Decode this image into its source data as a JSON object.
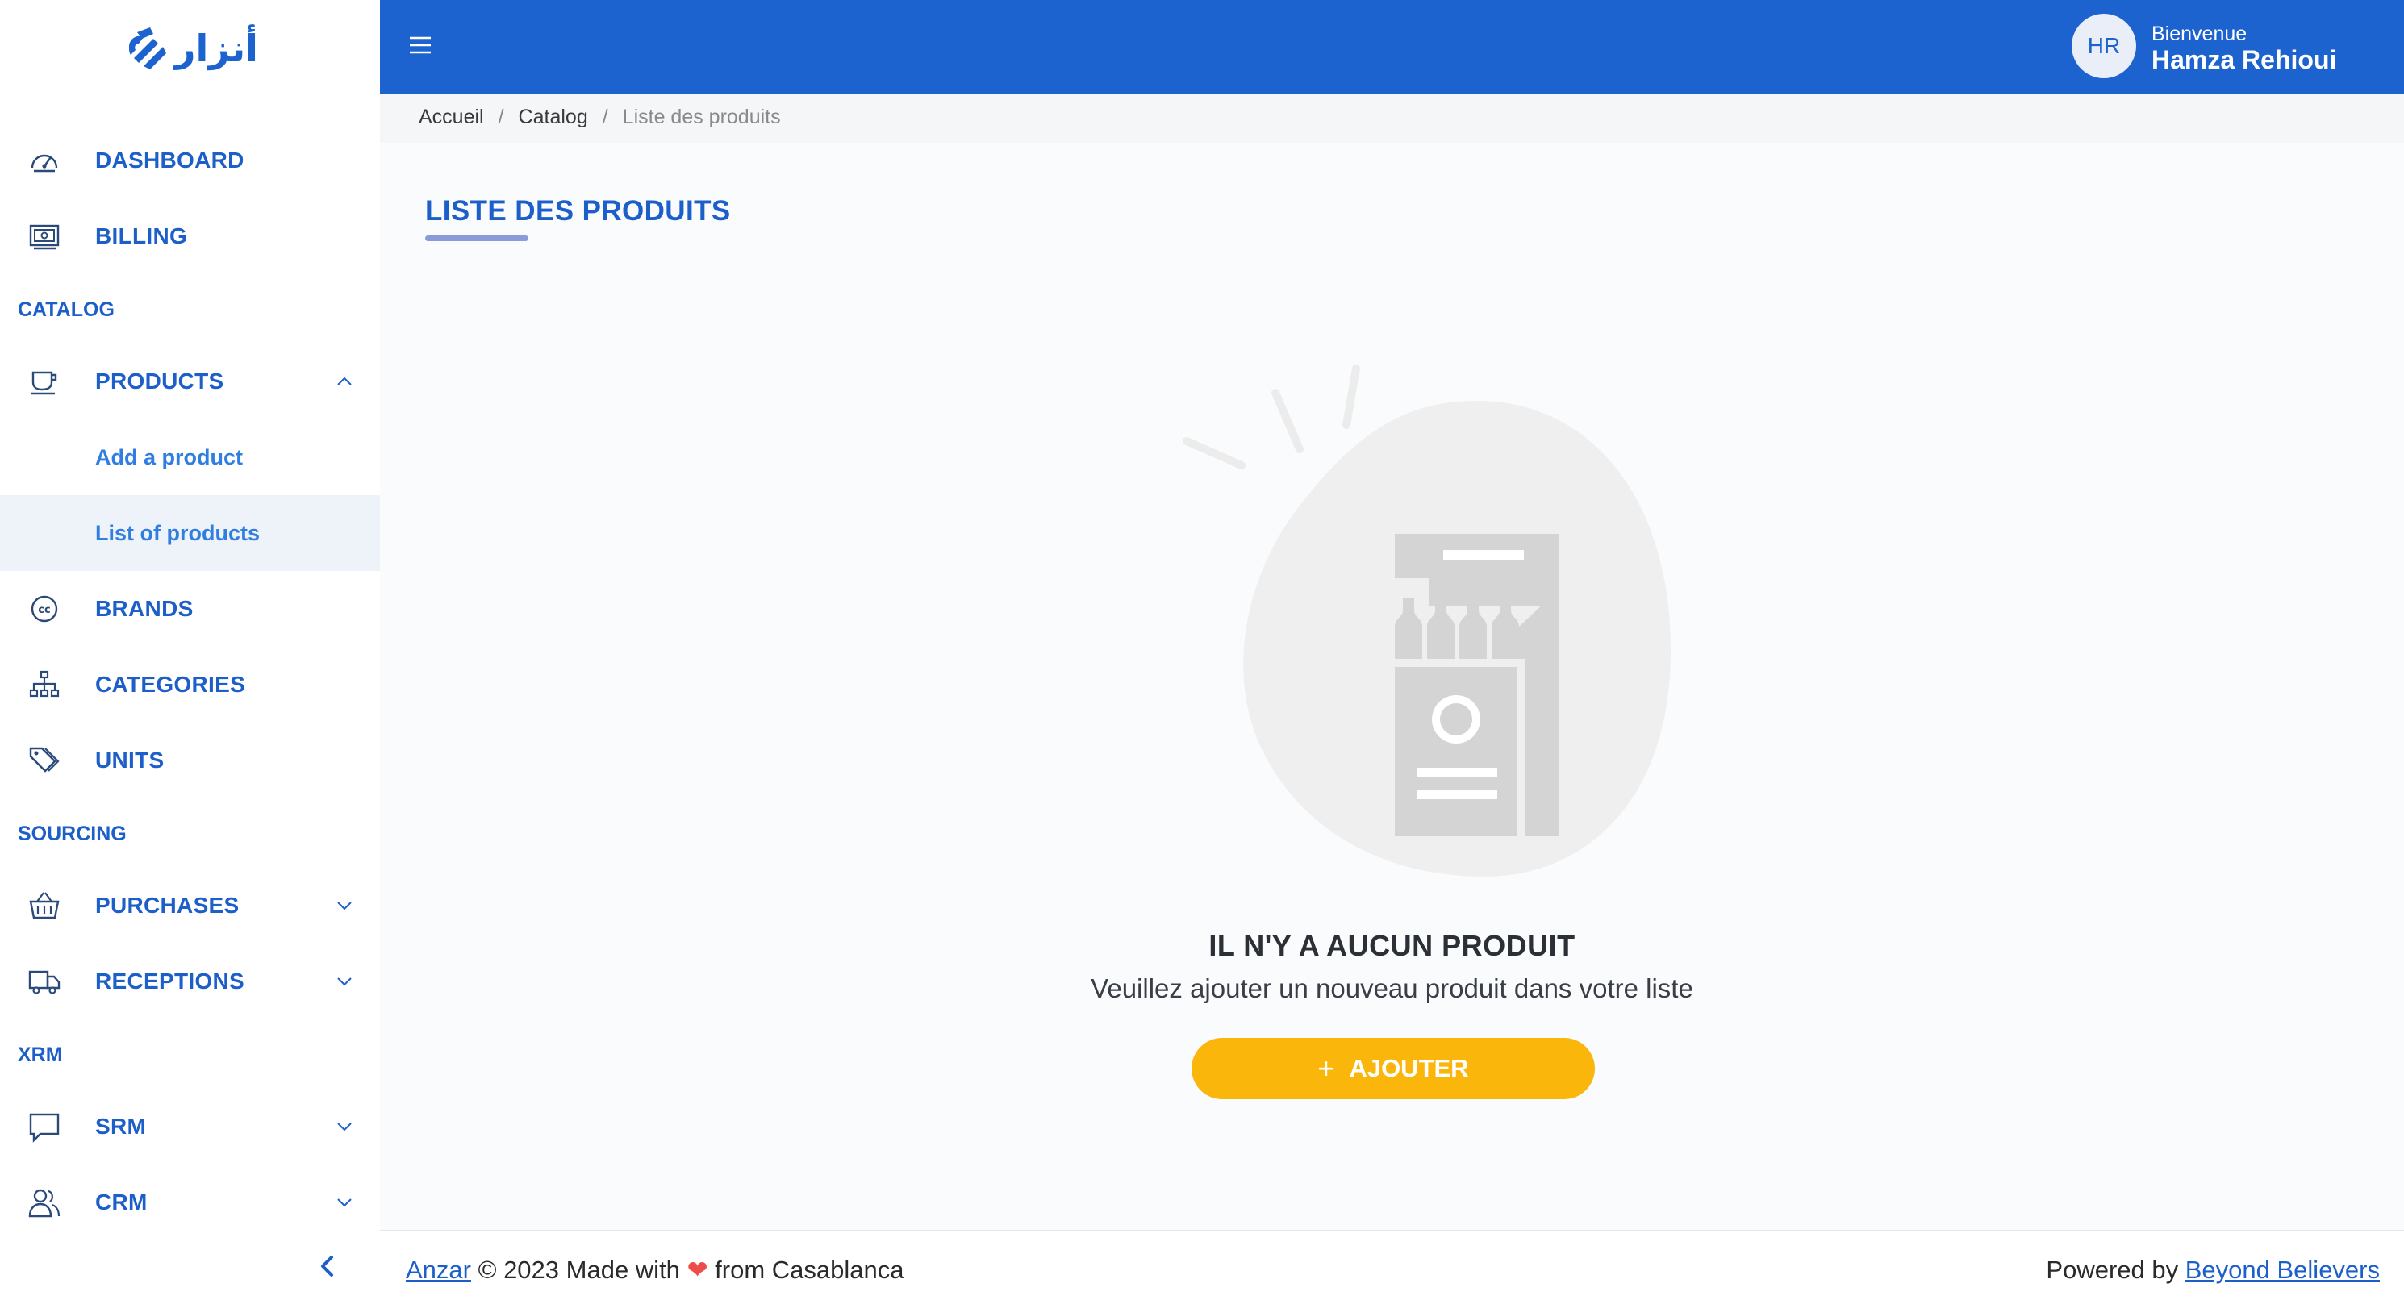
{
  "brand": {
    "logo_text": "أنزار"
  },
  "topbar": {
    "avatar_initials": "HR",
    "welcome": "Bienvenue",
    "user_name": "Hamza Rehioui"
  },
  "sidebar": {
    "items": {
      "dashboard": "DASHBOARD",
      "billing": "BILLING",
      "catalog_section": "CATALOG",
      "products": "PRODUCTS",
      "add_product": "Add a product",
      "list_products": "List of products",
      "brands": "BRANDS",
      "categories": "CATEGORIES",
      "units": "UNITS",
      "sourcing_section": "SOURCING",
      "purchases": "PURCHASES",
      "receptions": "RECEPTIONS",
      "xrm_section": "XRM",
      "srm": "SRM",
      "crm": "CRM"
    }
  },
  "breadcrumb": {
    "home": "Accueil",
    "catalog": "Catalog",
    "current": "Liste des produits",
    "separator": "/"
  },
  "main": {
    "title": "LISTE DES PRODUITS",
    "empty_title": "IL N'Y A AUCUN PRODUIT",
    "empty_subtitle": "Veuillez ajouter un nouveau produit dans votre liste",
    "add_button": "AJOUTER"
  },
  "footer": {
    "brand_link": "Anzar",
    "made_with": "© 2023 Made with",
    "from": "from Casablanca",
    "powered_by": "Powered by",
    "powered_link": "Beyond Believers"
  },
  "colors": {
    "primary": "#1d63cf",
    "accent": "#fbb60b",
    "heart": "#ef4b4b"
  }
}
